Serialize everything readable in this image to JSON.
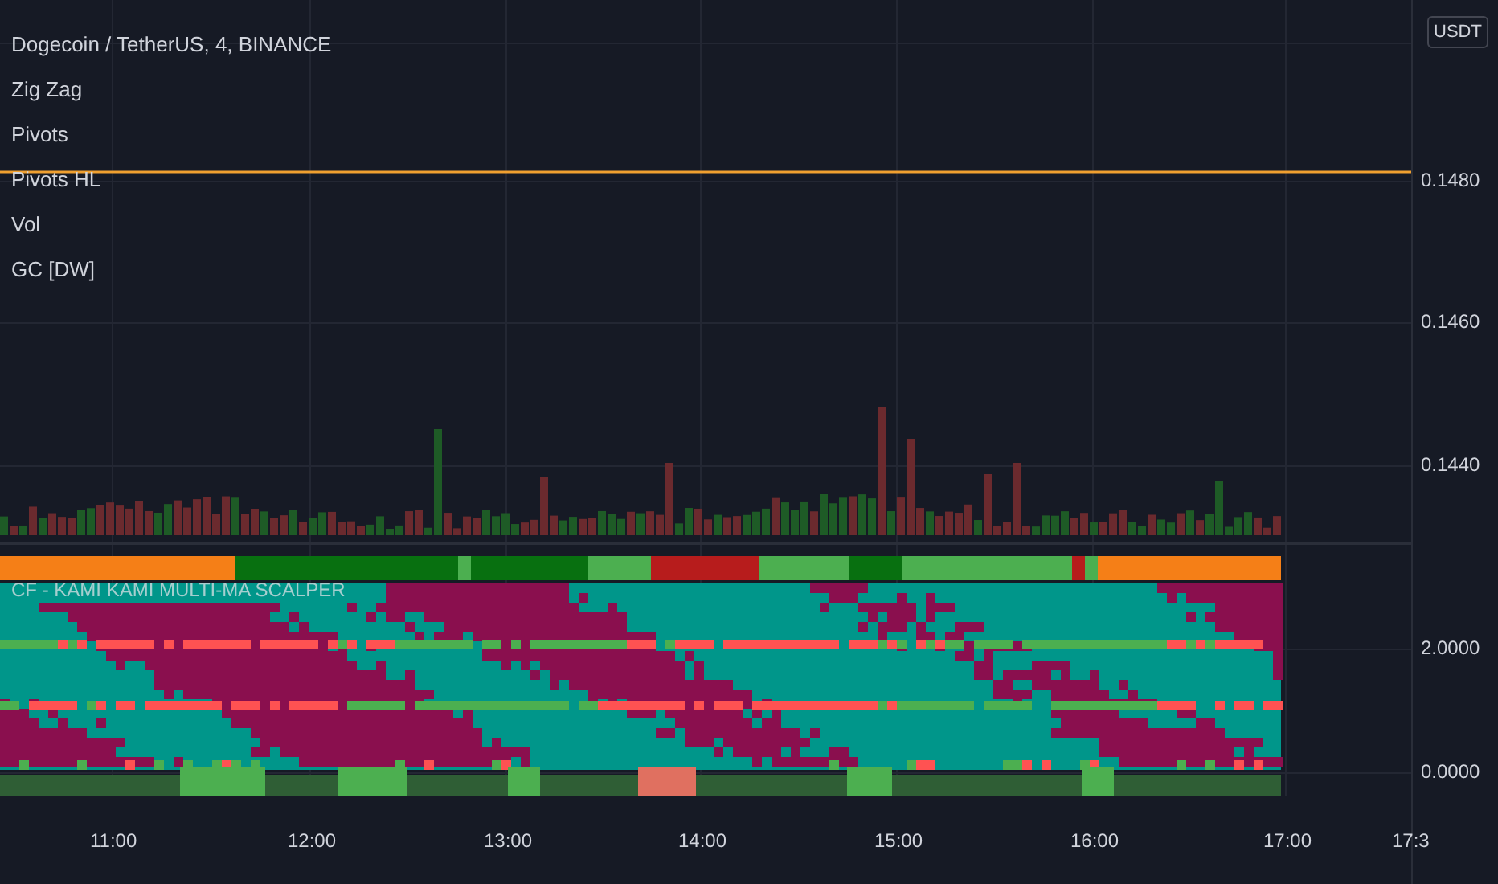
{
  "symbol_title": "Dogecoin / TetherUS, 4, BINANCE",
  "indicators": [
    "Zig Zag",
    "Pivots",
    "Pivots HL",
    "Vol",
    "GC [DW]"
  ],
  "price_axis": {
    "currency_badge": "USDT",
    "labels": [
      "0.1480",
      "0.1460",
      "0.1440"
    ]
  },
  "oscillator_pane": {
    "title": "CF - KAMI KAMI MULTI-MA SCALPER",
    "axis_labels": [
      "2.0000",
      "0.0000"
    ]
  },
  "time_axis": {
    "labels": [
      "11:00",
      "12:00",
      "13:00",
      "14:00",
      "15:00",
      "16:00",
      "17:00",
      "17:3"
    ]
  }
}
